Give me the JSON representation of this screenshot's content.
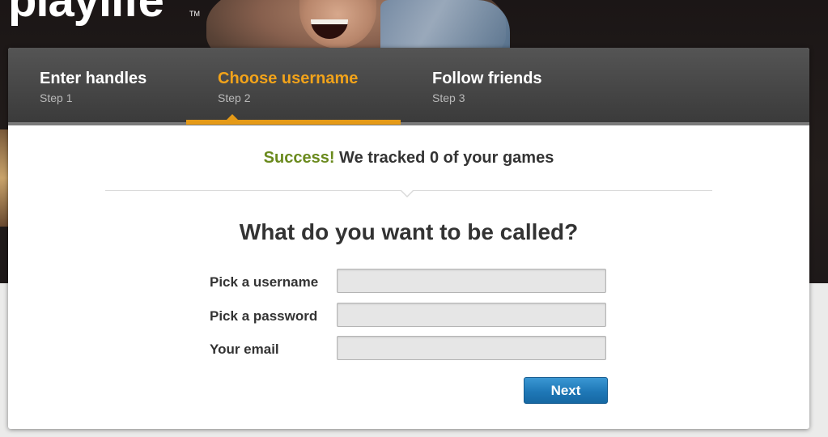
{
  "brand": {
    "logo_text": "playlife",
    "trademark": "TM"
  },
  "steps": [
    {
      "title": "Enter handles",
      "sub": "Step 1",
      "active": false
    },
    {
      "title": "Choose username",
      "sub": "Step 2",
      "active": true
    },
    {
      "title": "Follow friends",
      "sub": "Step 3",
      "active": false
    }
  ],
  "status": {
    "success_word": "Success!",
    "message": "We tracked 0 of your games"
  },
  "form": {
    "heading": "What do you want to be called?",
    "username_label": "Pick a username",
    "username_value": "",
    "password_label": "Pick a password",
    "password_value": "",
    "email_label": "Your email",
    "email_value": "",
    "next_label": "Next"
  },
  "colors": {
    "active_step": "#f2a31a",
    "success": "#6a8a1d",
    "button": "#1f78b7"
  }
}
